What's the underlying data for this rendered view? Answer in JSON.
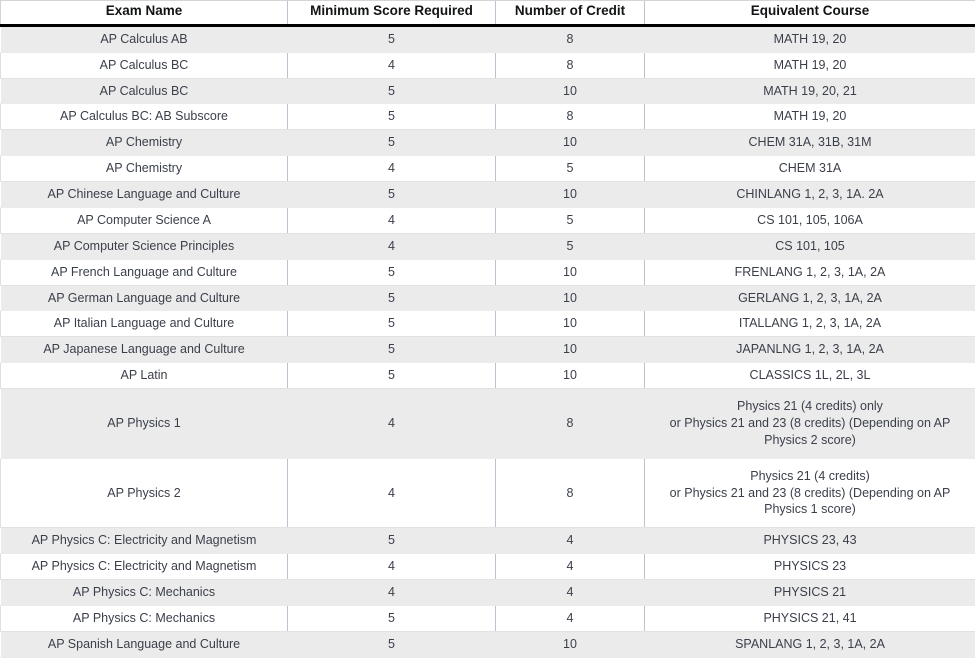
{
  "table": {
    "columns": [
      {
        "label": "Exam Name",
        "key": "exam"
      },
      {
        "label": "Minimum Score Required",
        "key": "score"
      },
      {
        "label": "Number of Credit",
        "key": "credit"
      },
      {
        "label": "Equivalent Course",
        "key": "course"
      }
    ],
    "rows": [
      {
        "exam": "AP Calculus AB",
        "score": "5",
        "credit": "8",
        "course": "MATH 19, 20"
      },
      {
        "exam": "AP Calculus BC",
        "score": "4",
        "credit": "8",
        "course": "MATH 19, 20"
      },
      {
        "exam": "AP Calculus BC",
        "score": "5",
        "credit": "10",
        "course": "MATH 19, 20, 21"
      },
      {
        "exam": "AP Calculus BC: AB Subscore",
        "score": "5",
        "credit": "8",
        "course": "MATH 19, 20"
      },
      {
        "exam": "AP Chemistry",
        "score": "5",
        "credit": "10",
        "course": "CHEM 31A, 31B, 31M"
      },
      {
        "exam": "AP Chemistry",
        "score": "4",
        "credit": "5",
        "course": "CHEM 31A"
      },
      {
        "exam": "AP Chinese Language and Culture",
        "score": "5",
        "credit": "10",
        "course": "CHINLANG 1, 2, 3, 1A. 2A"
      },
      {
        "exam": "AP Computer Science A",
        "score": "4",
        "credit": "5",
        "course": "CS 101, 105, 106A"
      },
      {
        "exam": "AP Computer Science Principles",
        "score": "4",
        "credit": "5",
        "course": "CS 101, 105"
      },
      {
        "exam": "AP French Language and Culture",
        "score": "5",
        "credit": "10",
        "course": "FRENLANG 1, 2, 3, 1A, 2A"
      },
      {
        "exam": "AP German Language and Culture",
        "score": "5",
        "credit": "10",
        "course": "GERLANG 1, 2, 3, 1A, 2A"
      },
      {
        "exam": "AP Italian Language and Culture",
        "score": "5",
        "credit": "10",
        "course": "ITALLANG 1, 2, 3, 1A, 2A"
      },
      {
        "exam": "AP Japanese Language and Culture",
        "score": "5",
        "credit": "10",
        "course": "JAPANLNG 1, 2, 3, 1A, 2A"
      },
      {
        "exam": "AP Latin",
        "score": "5",
        "credit": "10",
        "course": "CLASSICS 1L, 2L, 3L"
      },
      {
        "exam": "AP Physics 1",
        "score": "4",
        "credit": "8",
        "course": "Physics 21 (4 credits) only\nor Physics 21 and 23 (8 credits) (Depending on AP Physics 2 score)",
        "tall": true
      },
      {
        "exam": "AP Physics 2",
        "score": "4",
        "credit": "8",
        "course": "Physics 21 (4 credits)\nor Physics 21 and 23 (8 credits) (Depending on AP Physics 1 score)",
        "tall": true
      },
      {
        "exam": "AP Physics C: Electricity and Magnetism",
        "score": "5",
        "credit": "4",
        "course": "PHYSICS 23, 43"
      },
      {
        "exam": "AP Physics C: Electricity and Magnetism",
        "score": "4",
        "credit": "4",
        "course": "PHYSICS 23"
      },
      {
        "exam": "AP Physics C: Mechanics",
        "score": "4",
        "credit": "4",
        "course": "PHYSICS 21"
      },
      {
        "exam": "AP Physics C: Mechanics",
        "score": "5",
        "credit": "4",
        "course": "PHYSICS 21, 41"
      },
      {
        "exam": "AP Spanish Language and Culture",
        "score": "5",
        "credit": "10",
        "course": "SPANLANG 1, 2, 3, 1A, 2A"
      }
    ]
  },
  "colors": {
    "shaded_row": "#ebebeb",
    "divider": "#b8c4d0",
    "header_rule": "#000000",
    "body_text": "#3a3f4a",
    "header_text": "#111315"
  }
}
